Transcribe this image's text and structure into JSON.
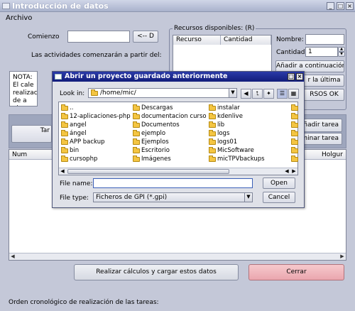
{
  "window": {
    "title": "Introducción de datos",
    "menu": [
      "Archivo"
    ]
  },
  "form": {
    "comienzo_label": "Comienzo",
    "comienzo_value": "",
    "set_date_button": "<-- D",
    "start_note": "Las actividades comenzarán a partir del:",
    "note_text": "NOTA: El cale realización de a viernes"
  },
  "resources": {
    "group_title": "Recursos disponibles: (R)",
    "columns": [
      "Recurso",
      "Cantidad"
    ],
    "nombre_label": "Nombre:",
    "nombre_value": "",
    "cantidad_label": "Cantidad:",
    "cantidad_value": "1",
    "add_button": "Añadir a continuación",
    "delete_partial": "r la última",
    "ok_partial": "RSOS OK"
  },
  "tasks": {
    "tab_partial": "Tar",
    "add_task_partial": "ñadir tarea",
    "delete_task_partial": "minar tarea",
    "columns": [
      "Num",
      "Holgur"
    ]
  },
  "buttons": {
    "calculate": "Realizar cálculos y cargar estos datos",
    "close": "Cerrar"
  },
  "footer": {
    "order_label": "Orden cronológico de realización de las tareas:"
  },
  "dialog": {
    "title": "Abrir un proyecto guardado anteriormente",
    "look_in_label": "Look in:",
    "look_in_value": "/home/mic/",
    "files": [
      [
        "..",
        "12-aplicaciones-php",
        "angel",
        "ángel",
        "APP backup",
        "bin",
        "cursophp"
      ],
      [
        "Descargas",
        "documentacion curso",
        "Documentos",
        "ejemplo",
        "Ejemplos",
        "Escritorio",
        "Imágenes"
      ],
      [
        "instalar",
        "kdenlive",
        "lib",
        "logs",
        "logs01",
        "MicSoftware",
        "micTPVbackups"
      ]
    ],
    "file_name_label": "File name:",
    "file_name_value": "",
    "file_type_label": "File type:",
    "file_type_value": "Ficheros de GPI (*.gpi)",
    "open_button": "Open",
    "cancel_button": "Cancel"
  },
  "colors": {
    "window_bg": "#c4c8d8",
    "dialog_title": "#1a2690",
    "close_button": "#f3b9bf"
  },
  "icons": [
    "window-icon",
    "folder-icon",
    "up-folder-icon",
    "home-icon",
    "new-folder-icon",
    "list-view-icon",
    "detail-view-icon"
  ]
}
